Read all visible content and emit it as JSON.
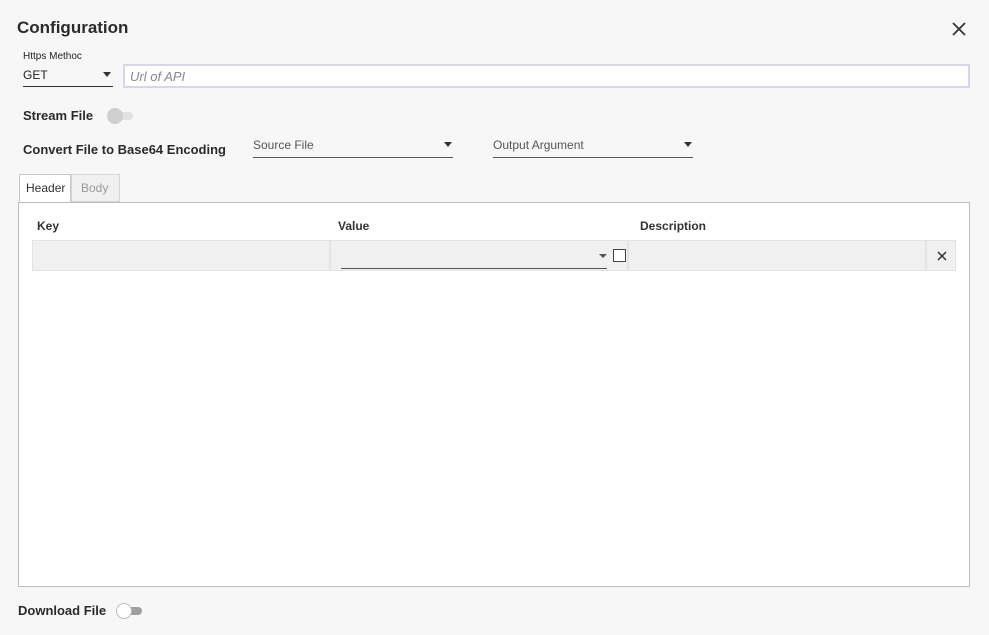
{
  "dialog": {
    "title": "Configuration",
    "close_icon": "close-icon"
  },
  "request": {
    "method_label": "Https Methoc",
    "method_value": "GET",
    "url_placeholder": "Url of API",
    "url_value": ""
  },
  "stream_file": {
    "label": "Stream File",
    "enabled": false
  },
  "base64": {
    "label": "Convert File to Base64 Encoding",
    "source_file": "Source File",
    "output_argument": "Output Argument"
  },
  "tabs": [
    {
      "label": "Header",
      "active": true
    },
    {
      "label": "Body",
      "active": false
    }
  ],
  "table": {
    "columns": [
      "Key",
      "Value",
      "Description"
    ],
    "rows": [
      {
        "key": "",
        "value": "",
        "description": ""
      }
    ]
  },
  "download_file": {
    "label": "Download File",
    "enabled": false
  }
}
